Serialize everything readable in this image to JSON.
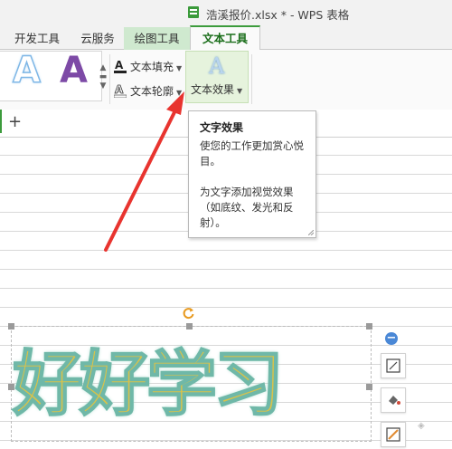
{
  "window": {
    "title": "浩溪报价.xlsx * - WPS 表格"
  },
  "menu": {
    "tabs": [
      {
        "label": "开发工具"
      },
      {
        "label": "云服务"
      },
      {
        "label": "绘图工具"
      },
      {
        "label": "文本工具"
      }
    ],
    "active_tab": "文本工具"
  },
  "ribbon": {
    "styles": [
      "A",
      "A"
    ],
    "text_fill_label": "文本填充",
    "text_outline_label": "文本轮廓",
    "text_effect_label": "文本效果",
    "effect_icon_glyph": "A"
  },
  "tooltip": {
    "title": "文字效果",
    "line1": "使您的工作更加赏心悦目。",
    "line2": "为文字添加视觉效果（如底纹、发光和反射）。"
  },
  "sheet": {
    "add_tab_label": "+"
  },
  "wordart": {
    "text": "好好学习"
  },
  "colors": {
    "accent": "#3c9b3c",
    "arrow": "#e8342f",
    "wordart_fill": "#d9c24a",
    "wordart_outline": "#6fb8a8"
  }
}
